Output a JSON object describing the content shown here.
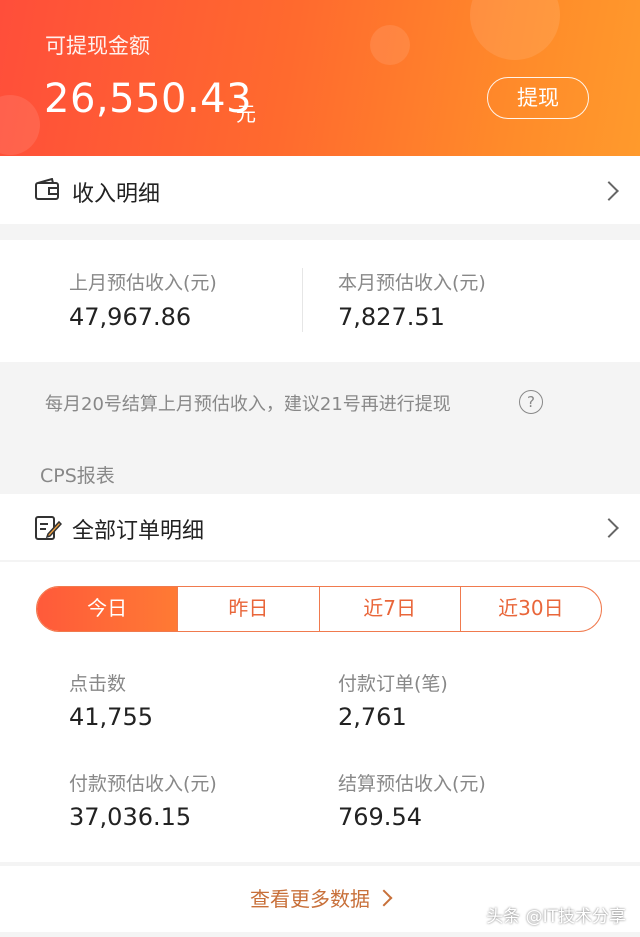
{
  "header": {
    "label": "可提现金额",
    "amount": "26,550.43",
    "unit": "元",
    "withdraw_label": "提现",
    "colors": {
      "gradient_start": "#ff4e3a",
      "gradient_end": "#ff9a2c"
    }
  },
  "income_detail": {
    "title": "收入明细",
    "icon": "wallet-icon"
  },
  "estimates": {
    "last_month_label": "上月预估收入(元)",
    "last_month_value": "47,967.86",
    "this_month_label": "本月预估收入(元)",
    "this_month_value": "7,827.51"
  },
  "notice": {
    "text": "每月20号结算上月预估收入，建议21号再进行提现",
    "icon": "help-icon",
    "icon_glyph": "?"
  },
  "cps": {
    "section_label": "CPS报表",
    "orders_title": "全部订单明细",
    "orders_icon": "edit-document-icon",
    "tabs": [
      {
        "label": "今日",
        "active": true
      },
      {
        "label": "昨日",
        "active": false
      },
      {
        "label": "近7日",
        "active": false
      },
      {
        "label": "近30日",
        "active": false
      }
    ],
    "stats": {
      "clicks_label": "点击数",
      "clicks_value": "41,755",
      "paid_orders_label": "付款订单(笔)",
      "paid_orders_value": "2,761",
      "paid_income_label": "付款预估收入(元)",
      "paid_income_value": "37,036.15",
      "settled_income_label": "结算预估收入(元)",
      "settled_income_value": "769.54"
    },
    "more_label": "查看更多数据"
  },
  "watermark": "头条 @IT技术分享"
}
